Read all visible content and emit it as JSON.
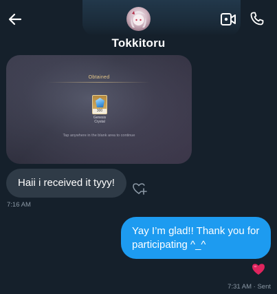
{
  "header": {
    "contact_name": "Tokkitoru",
    "back_icon": "arrow-left-icon",
    "video_icon": "video-call-icon",
    "phone_icon": "phone-icon"
  },
  "messages": [
    {
      "type": "image",
      "direction": "incoming",
      "image_text": {
        "title": "Obtained",
        "item_qty": "300",
        "item_name_line1": "Genesis",
        "item_name_line2": "Crystal",
        "hint": "Tap anywhere in the blank area to continue"
      }
    },
    {
      "type": "text",
      "direction": "incoming",
      "text": "Haii i received it tyyy!",
      "time": "7:16 AM",
      "react_icon": "heart-plus-icon"
    },
    {
      "type": "text",
      "direction": "outgoing",
      "text": "Yay I’m glad!! Thank you for participating ^_^",
      "reaction": "❤️",
      "status": "7:31 AM · Sent"
    }
  ],
  "colors": {
    "background": "#15202b",
    "incoming_bubble": "#2f3b47",
    "outgoing_bubble": "#1d9bf0",
    "meta_text": "#8b98a5",
    "reaction_heart": "#e0245e"
  }
}
